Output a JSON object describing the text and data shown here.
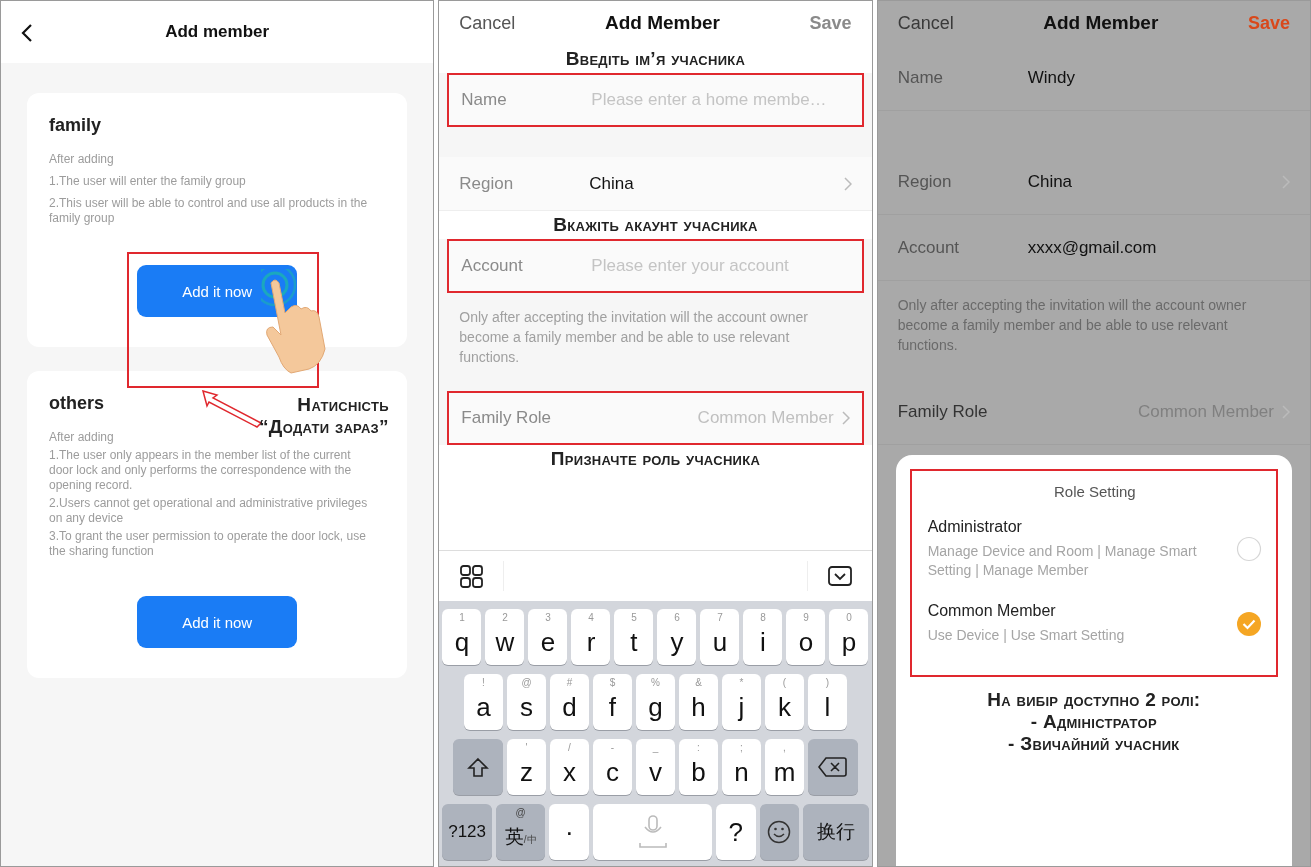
{
  "add_member_screen": {
    "title": "Add member",
    "sections": [
      {
        "title": "family",
        "lines": [
          "After adding",
          "1.The user will enter the family group",
          "2.This user will be able to control and use all products in the family group"
        ],
        "button": "Add it now",
        "highlighted": true
      },
      {
        "title": "others",
        "lines": [
          "After adding",
          "1.The user only appears in the member list of the current door lock and only performs the correspondence with the opening record.",
          "2.Users cannot get operational and administrative privileges on any device",
          "3.To grant the user permission to operate the door lock, use the sharing function"
        ],
        "button": "Add it now",
        "highlighted": false
      }
    ],
    "callout": [
      "Натисність",
      "“Додати зараз”"
    ]
  },
  "form_screen": {
    "dimmed": false,
    "header": {
      "cancel": "Cancel",
      "title": "Add Member",
      "save": "Save",
      "save_enabled": false
    },
    "rows": [
      {
        "kind": "annotation",
        "text": "Введіть ім’я учасника"
      },
      {
        "kind": "input",
        "label": "Name",
        "placeholder": "Please enter a home membe…",
        "highlighted": true
      },
      {
        "kind": "select",
        "label": "Region",
        "value": "China",
        "highlighted": false,
        "muted": false
      },
      {
        "kind": "annotation",
        "text": "Вкажіть акаунт учасника"
      },
      {
        "kind": "input",
        "label": "Account",
        "placeholder": "Please enter your account",
        "highlighted": true
      },
      {
        "kind": "note",
        "text": "Only after accepting the invitation will the account owner become a family member and be able to use relevant functions."
      },
      {
        "kind": "select",
        "label": "Family Role",
        "value": "Common Member",
        "highlighted": true,
        "muted": true
      },
      {
        "kind": "annotation",
        "text": "Призначте роль учасника"
      }
    ],
    "keyboard": {
      "rows": [
        {
          "keys": [
            {
              "kind": "letter",
              "label": "q",
              "hint": "1"
            },
            {
              "kind": "letter",
              "label": "w",
              "hint": "2"
            },
            {
              "kind": "letter",
              "label": "e",
              "hint": "3"
            },
            {
              "kind": "letter",
              "label": "r",
              "hint": "4"
            },
            {
              "kind": "letter",
              "label": "t",
              "hint": "5"
            },
            {
              "kind": "letter",
              "label": "y",
              "hint": "6"
            },
            {
              "kind": "letter",
              "label": "u",
              "hint": "7"
            },
            {
              "kind": "letter",
              "label": "i",
              "hint": "8"
            },
            {
              "kind": "letter",
              "label": "o",
              "hint": "9"
            },
            {
              "kind": "letter",
              "label": "p",
              "hint": "0"
            }
          ]
        },
        {
          "keys": [
            {
              "kind": "letter",
              "label": "a",
              "hint": "!"
            },
            {
              "kind": "letter",
              "label": "s",
              "hint": "@"
            },
            {
              "kind": "letter",
              "label": "d",
              "hint": "#"
            },
            {
              "kind": "letter",
              "label": "f",
              "hint": "$"
            },
            {
              "kind": "letter",
              "label": "g",
              "hint": "%"
            },
            {
              "kind": "letter",
              "label": "h",
              "hint": "&"
            },
            {
              "kind": "letter",
              "label": "j",
              "hint": "*"
            },
            {
              "kind": "letter",
              "label": "k",
              "hint": "("
            },
            {
              "kind": "letter",
              "label": "l",
              "hint": ")"
            }
          ]
        },
        {
          "keys": [
            {
              "kind": "shift"
            },
            {
              "kind": "letter",
              "label": "z",
              "hint": "'"
            },
            {
              "kind": "letter",
              "label": "x",
              "hint": "/"
            },
            {
              "kind": "letter",
              "label": "c",
              "hint": "-"
            },
            {
              "kind": "letter",
              "label": "v",
              "hint": "_"
            },
            {
              "kind": "letter",
              "label": "b",
              "hint": ":"
            },
            {
              "kind": "letter",
              "label": "n",
              "hint": ";"
            },
            {
              "kind": "letter",
              "label": "m",
              "hint": ","
            },
            {
              "kind": "backspace"
            }
          ]
        },
        {
          "keys": [
            {
              "kind": "mode",
              "label": "?123"
            },
            {
              "kind": "language",
              "label": "英",
              "sub": "/中",
              "hint": "@"
            },
            {
              "kind": "letter",
              "label": "·"
            },
            {
              "kind": "space"
            },
            {
              "kind": "letter",
              "label": "?"
            },
            {
              "kind": "emoji"
            },
            {
              "kind": "return",
              "label": "换行"
            }
          ]
        }
      ]
    }
  },
  "role_screen": {
    "dimmed": true,
    "header": {
      "cancel": "Cancel",
      "title": "Add Member",
      "save": "Save",
      "save_enabled": true
    },
    "rows": [
      {
        "kind": "input",
        "label": "Name",
        "value": "Windy",
        "highlighted": false
      },
      {
        "kind": "select",
        "label": "Region",
        "value": "China",
        "highlighted": false,
        "muted": false
      },
      {
        "kind": "input",
        "label": "Account",
        "value": "xxxx@gmail.com",
        "highlighted": false
      },
      {
        "kind": "note",
        "text": "Only after accepting the invitation will the account owner become a family member and be able to use relevant functions."
      },
      {
        "kind": "select",
        "label": "Family Role",
        "value": "Common Member",
        "highlighted": false,
        "muted": true
      }
    ],
    "sheet": {
      "title": "Role Setting",
      "highlighted": true,
      "options": [
        {
          "name": "Administrator",
          "description": "Manage Device and Room | Manage Smart Setting | Manage Member",
          "selected": false
        },
        {
          "name": "Common Member",
          "description": "Use Device | Use Smart Setting",
          "selected": true
        }
      ],
      "annotation": [
        "На вибір доступно 2 ролі:",
        "- Адміністратор",
        "- Звичайний учасник"
      ]
    }
  }
}
